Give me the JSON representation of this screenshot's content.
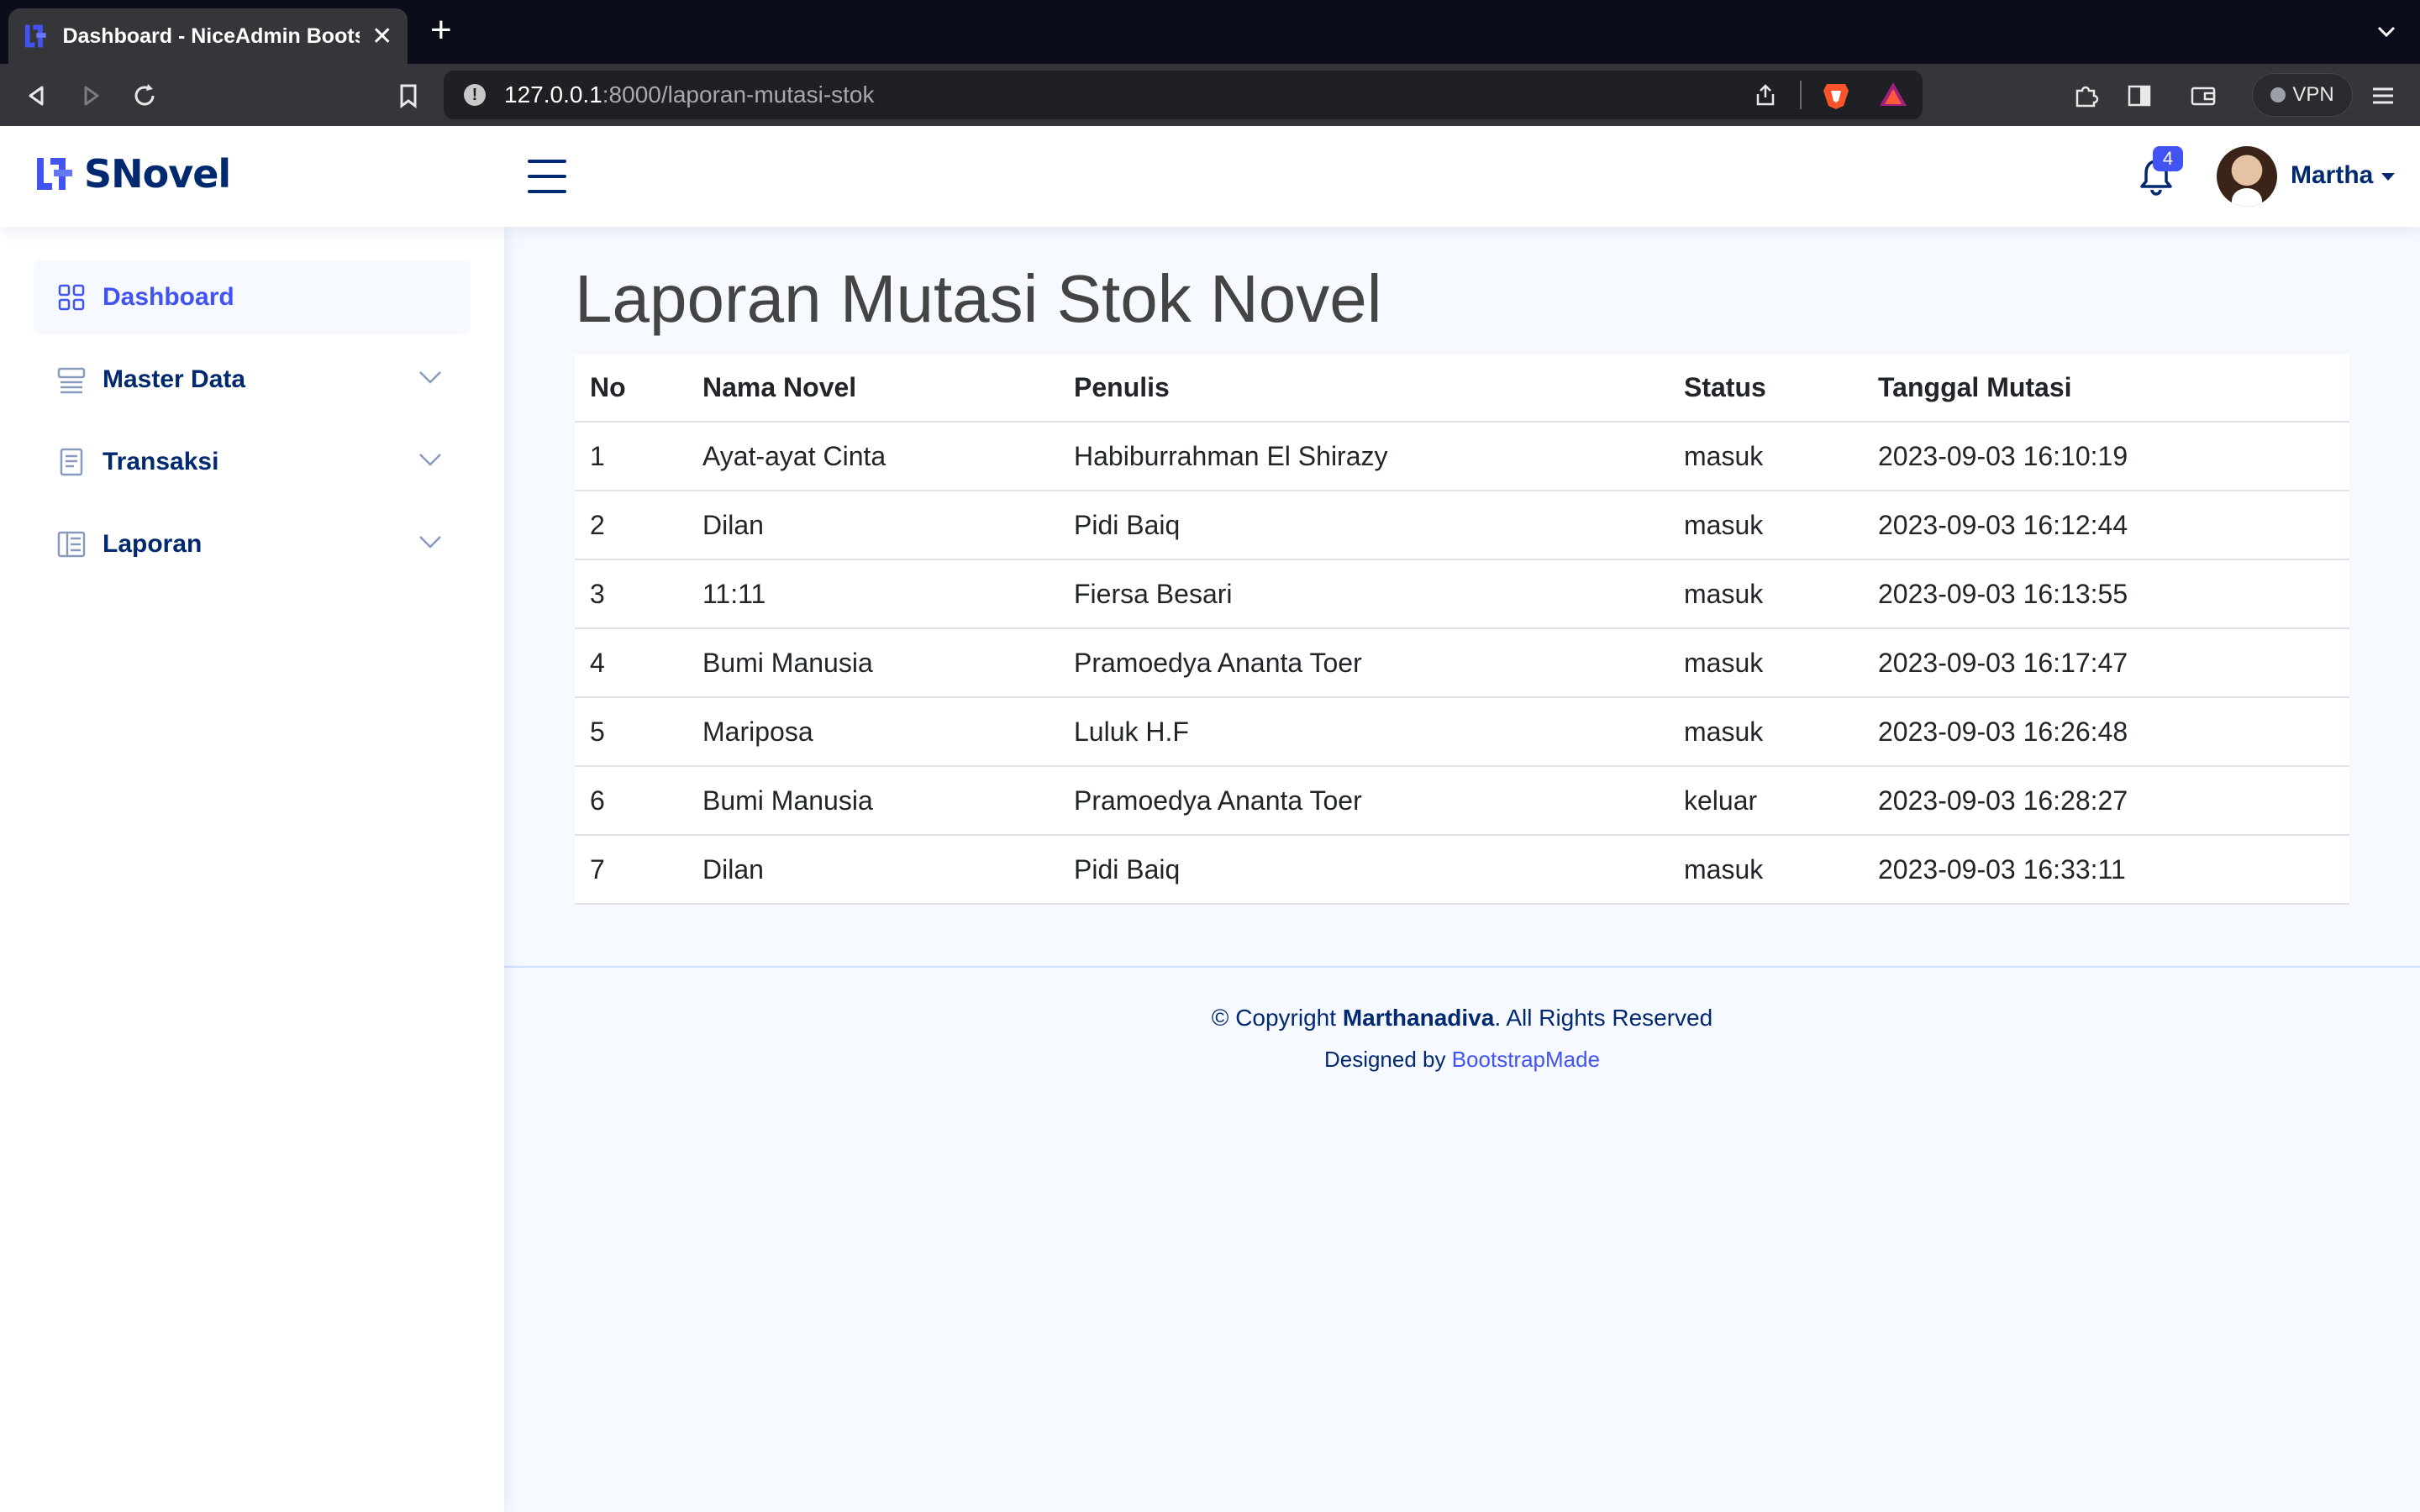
{
  "browser": {
    "tab_title": "Dashboard - NiceAdmin Bootstrap",
    "tab_close": "✕",
    "new_tab": "+",
    "url_host": "127.0.0.1",
    "url_path": ":8000/laporan-mutasi-stok",
    "vpn_label": "VPN"
  },
  "header": {
    "logo_text": "SNovel",
    "notification_count": "4",
    "user_name": "Martha"
  },
  "sidebar": {
    "items": [
      {
        "label": "Dashboard",
        "icon": "grid-icon",
        "active": true
      },
      {
        "label": "Master Data",
        "icon": "menu-button-icon",
        "active": false
      },
      {
        "label": "Transaksi",
        "icon": "journal-text-icon",
        "active": false
      },
      {
        "label": "Laporan",
        "icon": "layout-text-icon",
        "active": false
      }
    ]
  },
  "main": {
    "page_title": "Laporan Mutasi Stok Novel",
    "table": {
      "headers": [
        "No",
        "Nama Novel",
        "Penulis",
        "Status",
        "Tanggal Mutasi"
      ],
      "rows": [
        [
          "1",
          "Ayat-ayat Cinta",
          "Habiburrahman El Shirazy",
          "masuk",
          "2023-09-03 16:10:19"
        ],
        [
          "2",
          "Dilan",
          "Pidi Baiq",
          "masuk",
          "2023-09-03 16:12:44"
        ],
        [
          "3",
          "11:11",
          "Fiersa Besari",
          "masuk",
          "2023-09-03 16:13:55"
        ],
        [
          "4",
          "Bumi Manusia",
          "Pramoedya Ananta Toer",
          "masuk",
          "2023-09-03 16:17:47"
        ],
        [
          "5",
          "Mariposa",
          "Luluk H.F",
          "masuk",
          "2023-09-03 16:26:48"
        ],
        [
          "6",
          "Bumi Manusia",
          "Pramoedya Ananta Toer",
          "keluar",
          "2023-09-03 16:28:27"
        ],
        [
          "7",
          "Dilan",
          "Pidi Baiq",
          "masuk",
          "2023-09-03 16:33:11"
        ]
      ]
    }
  },
  "footer": {
    "copyright_prefix": "© Copyright ",
    "copyright_name": "Marthanadiva",
    "copyright_suffix": ". All Rights Reserved",
    "designed_by": "Designed by ",
    "designer_link": "BootstrapMade"
  },
  "colors": {
    "primary": "#4154f1",
    "navy": "#012970",
    "background": "#f6f9ff"
  }
}
